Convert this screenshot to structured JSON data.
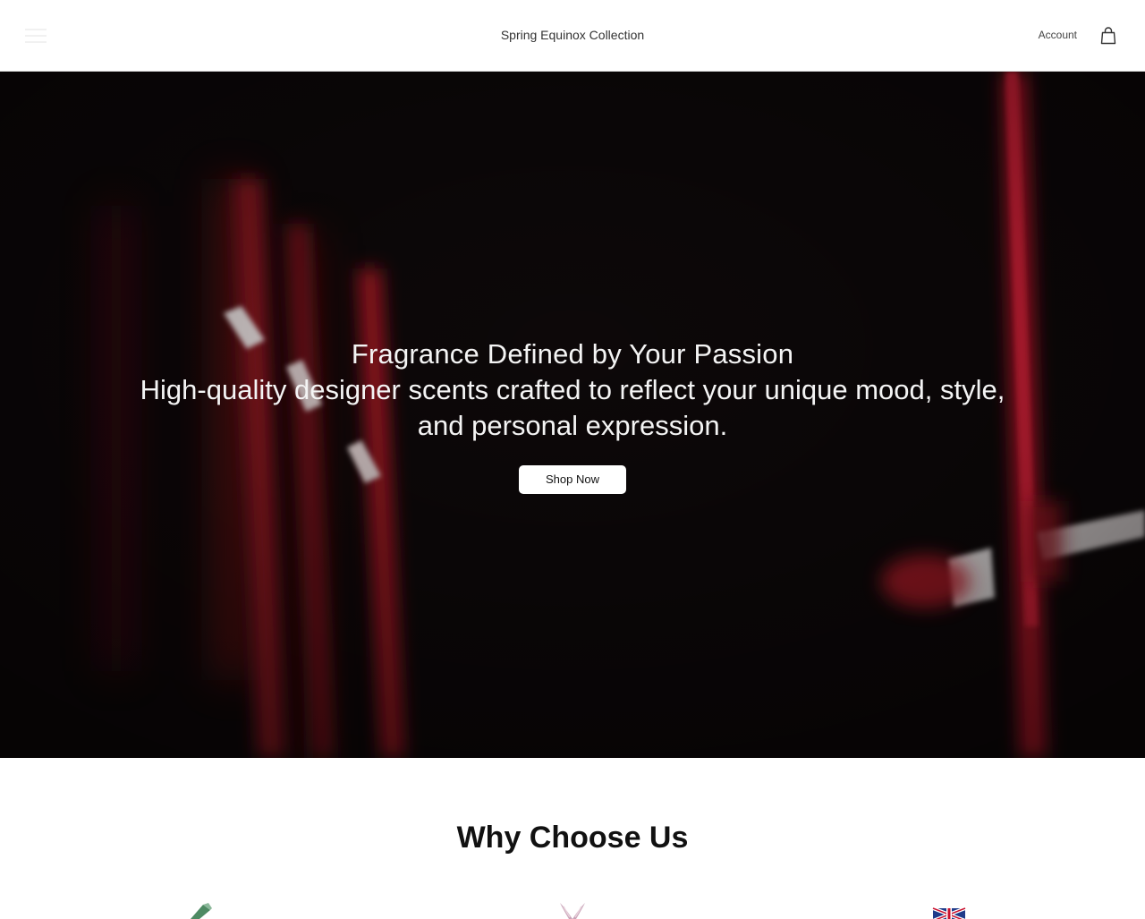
{
  "header": {
    "brand": "Spring Equinox Collection",
    "account_label": "Account"
  },
  "hero": {
    "title": "Fragrance Defined by Your Passion",
    "subtitle": "High-quality designer scents crafted to reflect your unique mood, style, and personal expression.",
    "cta_label": "Shop Now"
  },
  "why": {
    "title": "Why Choose Us",
    "features": [
      {
        "icon": "perfume-bottle-icon"
      },
      {
        "icon": "rabbit-icon"
      },
      {
        "icon": "uk-flag-icon"
      }
    ]
  },
  "colors": {
    "hero_accent": "#d3182b",
    "hero_bg": "#0b0708"
  }
}
